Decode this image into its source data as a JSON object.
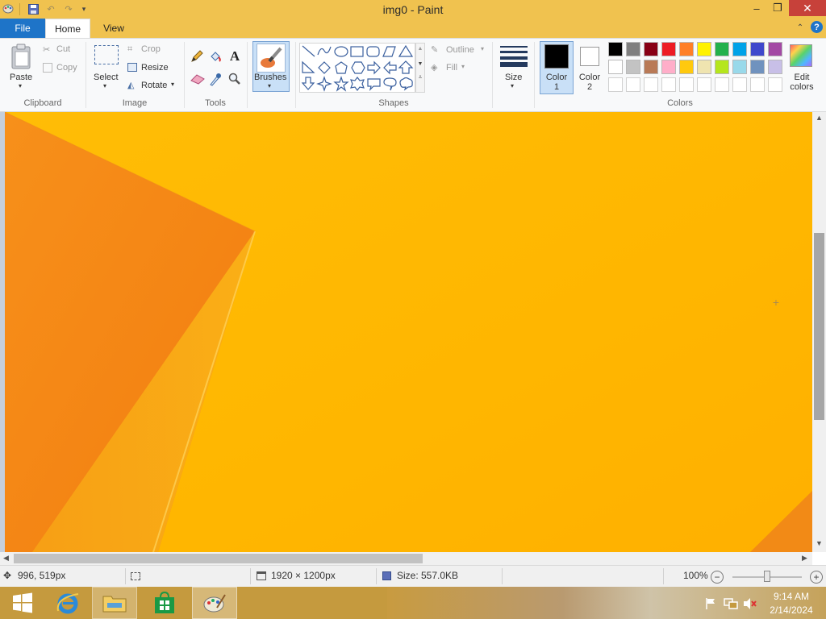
{
  "window": {
    "title": "img0 - Paint"
  },
  "tabs": {
    "file": "File",
    "home": "Home",
    "view": "View"
  },
  "clipboard": {
    "paste": "Paste",
    "cut": "Cut",
    "copy": "Copy",
    "group": "Clipboard"
  },
  "image": {
    "select": "Select",
    "crop": "Crop",
    "resize": "Resize",
    "rotate": "Rotate",
    "group": "Image"
  },
  "tools": {
    "group": "Tools",
    "text_glyph": "A"
  },
  "brushes": {
    "label": "Brushes"
  },
  "shapes": {
    "outline": "Outline",
    "fill": "Fill",
    "group": "Shapes"
  },
  "size": {
    "label": "Size"
  },
  "colors": {
    "color1_line1": "Color",
    "color1_line2": "1",
    "color2_line1": "Color",
    "color2_line2": "2",
    "edit_line1": "Edit",
    "edit_line2": "colors",
    "group": "Colors",
    "color1_value": "#000000",
    "color2_value": "#ffffff",
    "palette": [
      [
        "#000000",
        "#7f7f7f",
        "#880015",
        "#ed1c24",
        "#ff7f27",
        "#fff200",
        "#22b14c",
        "#00a2e8",
        "#3f48cc",
        "#a349a4"
      ],
      [
        "#ffffff",
        "#c3c3c3",
        "#b97a57",
        "#ffaec9",
        "#ffc90e",
        "#efe4b0",
        "#b5e61d",
        "#99d9ea",
        "#7092be",
        "#c8bfe7"
      ],
      [
        "#ffffff",
        "#ffffff",
        "#ffffff",
        "#ffffff",
        "#ffffff",
        "#ffffff",
        "#ffffff",
        "#ffffff",
        "#ffffff",
        "#ffffff"
      ]
    ]
  },
  "status": {
    "cursor_pos": "996, 519px",
    "dimensions": "1920 × 1200px",
    "size": "Size: 557.0KB",
    "zoom": "100%",
    "zoom_value": 0.5
  },
  "taskbar": {
    "time": "9:14 AM",
    "date": "2/14/2024"
  },
  "theme": {
    "accent": "#f0c24f",
    "file_tab": "#1e74c8",
    "close": "#c7413a",
    "canvas_orange": "#ffb400"
  }
}
